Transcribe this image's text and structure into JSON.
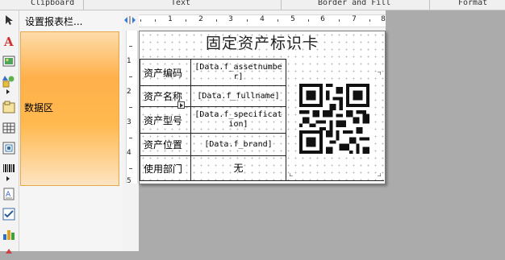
{
  "ribbon": {
    "groups": [
      "Clipboard",
      "Text",
      "Border and Fill",
      "Format"
    ]
  },
  "toolbox": {
    "tools": [
      "pointer-icon",
      "text-tool-icon",
      "picture-tool-icon",
      "shape-tool-icon",
      "container-tool-icon",
      "table-tool-icon",
      "chart-tool-icon",
      "barcode-tool-icon",
      "rich-text-tool-icon",
      "checkbox-tool-icon",
      "bar-chart-tool-icon"
    ]
  },
  "band_panel": {
    "header": "设置报表栏...",
    "data_band": "数据区"
  },
  "ruler": {
    "marks": [
      "1",
      "2",
      "3",
      "4",
      "5",
      "6",
      "7",
      "8"
    ],
    "vertical_marks": [
      "1",
      "2",
      "3",
      "4",
      "5"
    ]
  },
  "card": {
    "title": "固定资产标识卡",
    "rows": [
      {
        "label": "资产编码",
        "value": "[Data.f_assetnumber]"
      },
      {
        "label": "资产名称",
        "value": "[Data.f_fullname]"
      },
      {
        "label": "资产型号",
        "value": "[Data.f_specification]"
      },
      {
        "label": "资产位置",
        "value": "[Data.f_brand]"
      },
      {
        "label": "使用部门",
        "value": "无"
      }
    ]
  },
  "colors": {
    "band_orange": "#ffb04a",
    "workspace_gray": "#ababab",
    "canvas_white": "#ffffff"
  }
}
